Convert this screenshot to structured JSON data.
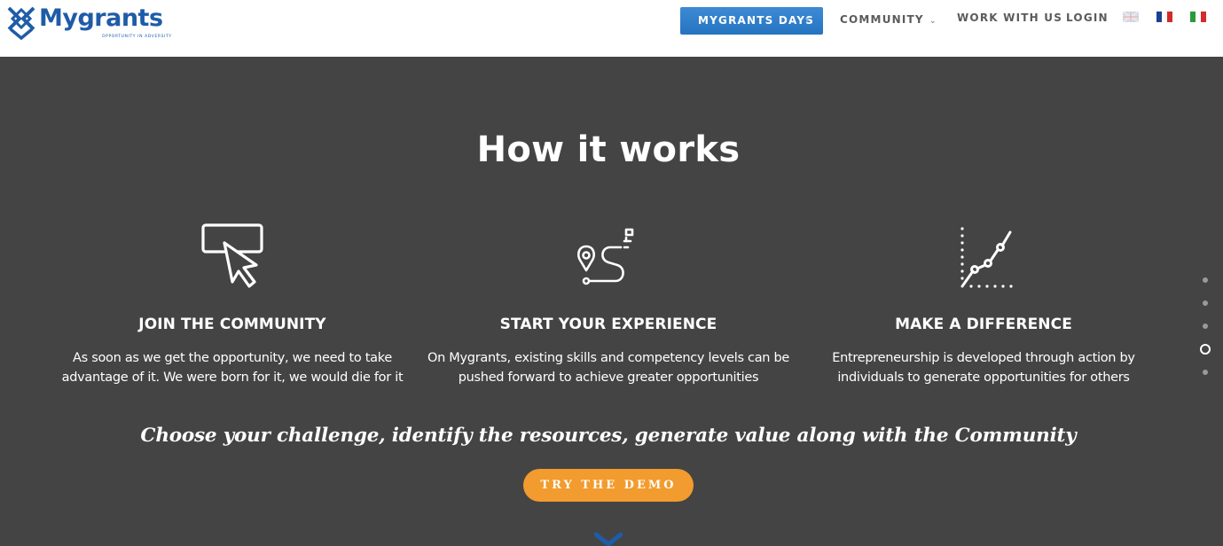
{
  "header": {
    "logo_text": "Mygrants",
    "logo_tagline": "OPPORTUNITY IN ADVERSITY",
    "nav": {
      "days_label": "MYGRANTS DAYS",
      "community_label": "COMMUNITY",
      "work_label": "WORK WITH US",
      "login_label": "LOGIN"
    },
    "languages": [
      "en-flag-icon",
      "fr-flag-icon",
      "it-flag-icon"
    ]
  },
  "section": {
    "title": "How it works",
    "features": [
      {
        "icon": "cursor-click-icon",
        "title": "JOIN THE COMMUNITY",
        "description": "As soon as we get the opportunity, we need to take advantage of it. We were born for it, we would die for it"
      },
      {
        "icon": "route-pin-icon",
        "title": "START YOUR EXPERIENCE",
        "description": "On Mygrants, existing skills and competency levels can be pushed forward to achieve greater opportunities"
      },
      {
        "icon": "growth-chart-icon",
        "title": "MAKE A DIFFERENCE",
        "description": "Entrepreneurship is developed through action by individuals to generate opportunities for others"
      }
    ],
    "tagline": "Choose your challenge, identify the resources, generate value along with the Community",
    "demo_button": "TRY THE DEMO"
  },
  "side_nav": {
    "count": 5,
    "active_index": 3
  },
  "colors": {
    "brand_blue": "#1f5ca8",
    "nav_button": "#2f80cc",
    "background": "#444444",
    "cta_orange": "#f29b2e"
  }
}
